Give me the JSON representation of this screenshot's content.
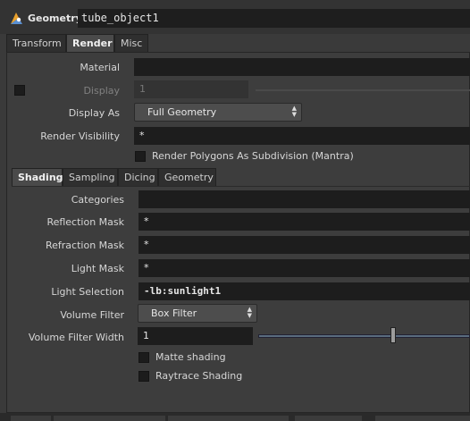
{
  "header": {
    "node_type": "Geometry",
    "node_name": "tube_object1",
    "logo_icon": "geometry-node-icon"
  },
  "main_tabs": [
    "Transform",
    "Render",
    "Misc"
  ],
  "render": {
    "material": {
      "label": "Material",
      "value": ""
    },
    "display": {
      "label": "Display",
      "value": "1",
      "enabled": false
    },
    "display_as": {
      "label": "Display As",
      "value": "Full Geometry"
    },
    "render_visibility": {
      "label": "Render Visibility",
      "value": "*"
    },
    "subdivision": {
      "label": "Render Polygons As Subdivision (Mantra)",
      "checked": false
    }
  },
  "sub_tabs": [
    "Shading",
    "Sampling",
    "Dicing",
    "Geometry"
  ],
  "shading": {
    "categories": {
      "label": "Categories",
      "value": ""
    },
    "reflection_mask": {
      "label": "Reflection Mask",
      "value": "*"
    },
    "refraction_mask": {
      "label": "Refraction Mask",
      "value": "*"
    },
    "light_mask": {
      "label": "Light Mask",
      "value": "*"
    },
    "light_selection": {
      "label": "Light Selection",
      "value": "-lb:sunlight1"
    },
    "volume_filter": {
      "label": "Volume Filter",
      "value": "Box Filter"
    },
    "volume_filter_width": {
      "label": "Volume Filter Width",
      "value": "1",
      "slider_fraction": 0.72
    },
    "matte_shading": {
      "label": "Matte shading",
      "checked": false
    },
    "raytrace_shading": {
      "label": "Raytrace Shading",
      "checked": false
    }
  },
  "colors": {
    "background": "#3a3a3a",
    "field": "#1d1d1d",
    "slider_accent": "#5a6c7e"
  }
}
